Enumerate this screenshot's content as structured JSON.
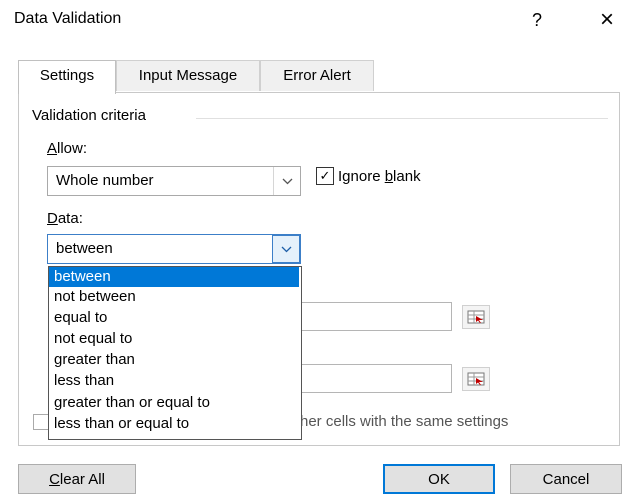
{
  "dialog": {
    "title": "Data Validation",
    "help_label": "?",
    "close_label": "×"
  },
  "tabs": [
    {
      "label": "Settings",
      "active": true
    },
    {
      "label": "Input Message",
      "active": false
    },
    {
      "label": "Error Alert",
      "active": false
    }
  ],
  "settings": {
    "group_title": "Validation criteria",
    "allow": {
      "label_hotkey": "A",
      "label_rest": "llow:",
      "value": "Whole number"
    },
    "ignore_blank": {
      "checked": true,
      "check_glyph": "✓",
      "label_pre": "Ignore ",
      "label_hotkey": "b",
      "label_post": "lank"
    },
    "data": {
      "label_hotkey": "D",
      "label_rest": "ata:",
      "value": "between",
      "dropdown_glyph": "⌄"
    },
    "data_options": [
      "between",
      "not between",
      "equal to",
      "not equal to",
      "greater than",
      "less than",
      "greater than or equal to",
      "less than or equal to"
    ],
    "selected_option": "between",
    "apply_all_partial_text": "her cells with the same settings"
  },
  "buttons": {
    "clear_all_hotkey": "C",
    "clear_all_rest": "lear All",
    "ok": "OK",
    "cancel": "Cancel"
  },
  "colors": {
    "selection": "#0078d7",
    "focus_border": "#3c7fc8"
  }
}
